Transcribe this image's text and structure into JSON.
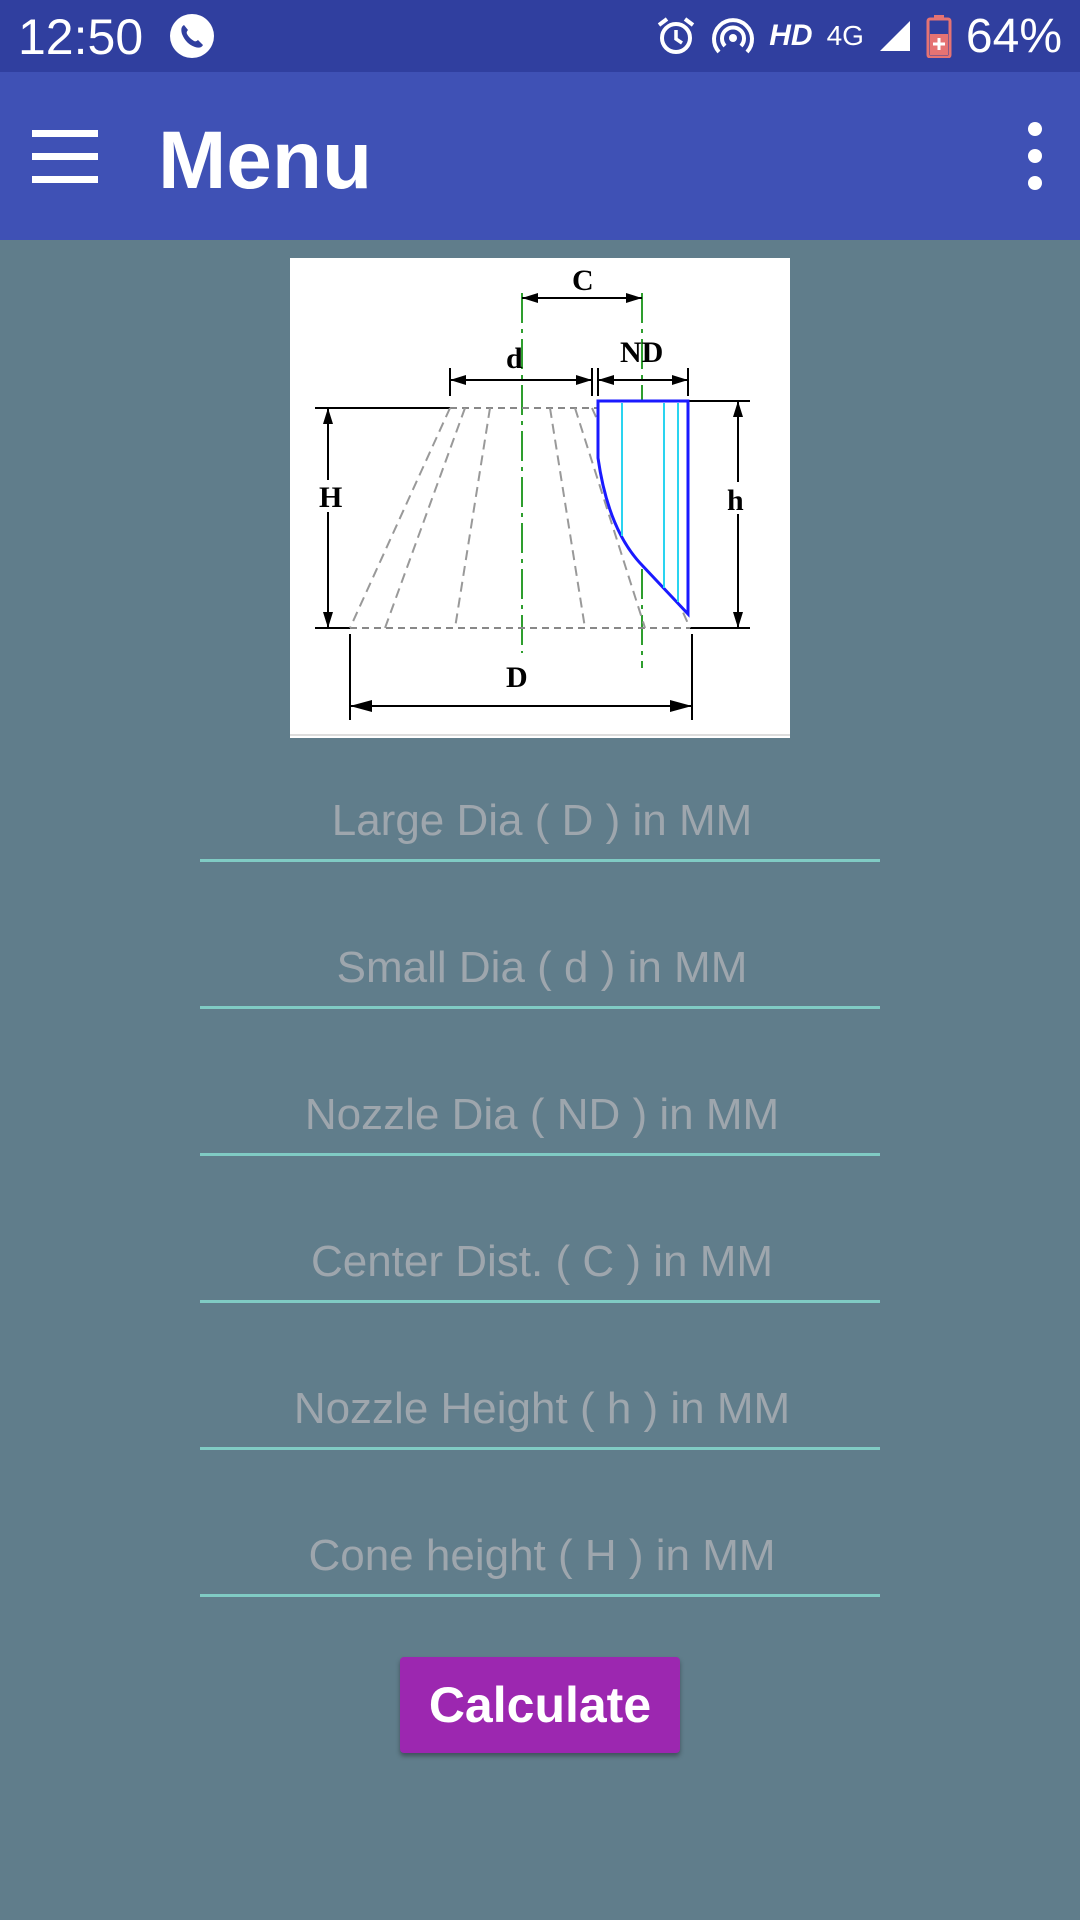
{
  "status_bar": {
    "time": "12:50",
    "network_hd": "HD",
    "network_type": "4G",
    "battery": "64%"
  },
  "app_bar": {
    "title": "Menu"
  },
  "diagram": {
    "labels": {
      "C": "C",
      "d": "d",
      "ND": "ND",
      "H": "H",
      "h": "h",
      "D": "D"
    }
  },
  "form": {
    "large_dia_placeholder": "Large Dia ( D ) in MM",
    "small_dia_placeholder": "Small Dia ( d ) in MM",
    "nozzle_dia_placeholder": "Nozzle Dia ( ND ) in MM",
    "center_dist_placeholder": "Center Dist. ( C ) in MM",
    "nozzle_height_placeholder": "Nozzle Height ( h ) in MM",
    "cone_height_placeholder": "Cone height ( H ) in MM",
    "calculate_label": "Calculate"
  },
  "colors": {
    "status_bar": "#303f9f",
    "app_bar": "#3f51b5",
    "background": "#607d8b",
    "field_underline": "#80cbc4",
    "button": "#9c27b0"
  }
}
